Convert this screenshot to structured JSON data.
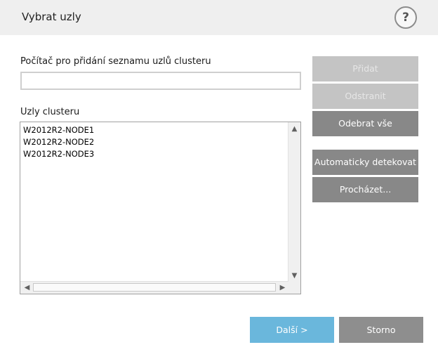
{
  "dialog": {
    "title": "Vybrat uzly",
    "help_label": "?"
  },
  "form": {
    "computer_label": "Počítač pro přidání seznamu uzlů clusteru",
    "computer_value": "",
    "nodes_label": "Uzly clusteru",
    "nodes": [
      "W2012R2-NODE1",
      "W2012R2-NODE2",
      "W2012R2-NODE3"
    ]
  },
  "buttons": {
    "add": "Přidat",
    "remove": "Odstranit",
    "remove_all": "Odebrat vše",
    "auto_detect": "Automaticky detekovat",
    "browse": "Procházet...",
    "next": "Další >",
    "cancel": "Storno"
  },
  "icons": {
    "scroll_up": "▲",
    "scroll_down": "▼",
    "scroll_left": "◀",
    "scroll_right": "▶"
  },
  "colors": {
    "header_bg": "#efefef",
    "button_active": "#888888",
    "button_disabled": "#c4c4c4",
    "primary": "#6ab7dc"
  }
}
